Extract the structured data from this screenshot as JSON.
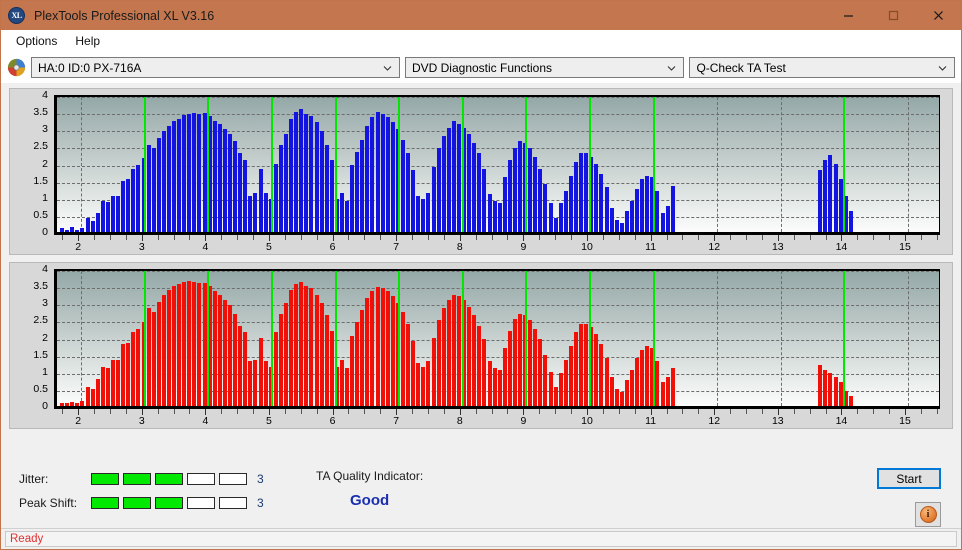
{
  "window": {
    "title": "PlexTools Professional XL V3.16",
    "app_icon": "xl-logo-icon",
    "minimize_label": "minimize-icon",
    "maximize_label": "maximize-icon",
    "close_label": "close-icon"
  },
  "menu": {
    "items": [
      {
        "label": "Options"
      },
      {
        "label": "Help"
      }
    ]
  },
  "toolbar": {
    "disc_icon": "disc-icon",
    "drive_select": {
      "value": "HA:0 ID:0  PX-716A"
    },
    "function_select": {
      "value": "DVD Diagnostic Functions"
    },
    "test_select": {
      "value": "Q-Check TA Test"
    }
  },
  "results": {
    "jitter": {
      "label": "Jitter:",
      "value": "3",
      "filled": 3,
      "total": 5
    },
    "peak_shift": {
      "label": "Peak Shift:",
      "value": "3",
      "filled": 3,
      "total": 5
    },
    "ta_quality": {
      "label": "TA Quality Indicator:",
      "value": "Good"
    },
    "start_button": "Start",
    "info_button": "info-icon"
  },
  "statusbar": {
    "text": "Ready"
  },
  "chart_data": [
    {
      "id": "jitter-chart",
      "type": "bar",
      "title": "",
      "xlabel": "",
      "ylabel": "",
      "color": "#1414e0",
      "xlim": [
        1.62,
        15.55
      ],
      "ylim": [
        0,
        4
      ],
      "yticks": [
        0,
        0.5,
        1,
        1.5,
        2,
        2.5,
        3,
        3.5,
        4
      ],
      "ytick_labels": [
        "0",
        "0.5",
        "1",
        "1.5",
        "2",
        "2.5",
        "3",
        "3.5",
        "4"
      ],
      "xticks": [
        2,
        3,
        4,
        5,
        6,
        7,
        8,
        9,
        10,
        11,
        12,
        13,
        14,
        15
      ],
      "xtick_labels": [
        "2",
        "3",
        "4",
        "5",
        "6",
        "7",
        "8",
        "9",
        "10",
        "11",
        "12",
        "13",
        "14",
        "15"
      ],
      "green_gridlines": [
        3,
        4,
        5,
        6,
        7,
        8,
        9,
        10,
        11,
        14
      ],
      "grid": true,
      "x": [
        1.7,
        1.78,
        1.86,
        1.94,
        2.02,
        2.1,
        2.18,
        2.26,
        2.34,
        2.42,
        2.5,
        2.58,
        2.66,
        2.74,
        2.82,
        2.9,
        2.98,
        3.06,
        3.14,
        3.22,
        3.3,
        3.38,
        3.46,
        3.54,
        3.62,
        3.7,
        3.78,
        3.86,
        3.94,
        4.02,
        4.1,
        4.18,
        4.26,
        4.34,
        4.42,
        4.5,
        4.58,
        4.66,
        4.74,
        4.82,
        4.9,
        4.98,
        5.06,
        5.14,
        5.22,
        5.3,
        5.38,
        5.46,
        5.54,
        5.62,
        5.7,
        5.78,
        5.86,
        5.94,
        6.02,
        6.1,
        6.18,
        6.26,
        6.34,
        6.42,
        6.5,
        6.58,
        6.66,
        6.74,
        6.82,
        6.9,
        6.98,
        7.06,
        7.14,
        7.22,
        7.3,
        7.38,
        7.46,
        7.54,
        7.62,
        7.7,
        7.78,
        7.86,
        7.94,
        8.02,
        8.1,
        8.18,
        8.26,
        8.34,
        8.42,
        8.5,
        8.58,
        8.66,
        8.74,
        8.82,
        8.9,
        8.98,
        9.06,
        9.14,
        9.22,
        9.3,
        9.38,
        9.46,
        9.54,
        9.62,
        9.7,
        9.78,
        9.86,
        9.94,
        10.02,
        10.1,
        10.18,
        10.26,
        10.34,
        10.42,
        10.5,
        10.58,
        10.66,
        10.74,
        10.82,
        10.9,
        10.98,
        11.06,
        11.14,
        11.22,
        11.3,
        13.62,
        13.7,
        13.78,
        13.86,
        13.94,
        14.02,
        14.1,
        14.18,
        14.26
      ],
      "values": [
        0.12,
        0.05,
        0.14,
        0.05,
        0.12,
        0.4,
        0.32,
        0.55,
        0.9,
        0.88,
        1.05,
        1.05,
        1.5,
        1.55,
        1.85,
        1.95,
        2.15,
        2.55,
        2.45,
        2.75,
        2.95,
        3.1,
        3.25,
        3.3,
        3.42,
        3.45,
        3.48,
        3.45,
        3.48,
        3.4,
        3.25,
        3.15,
        3.0,
        2.85,
        2.65,
        2.3,
        2.1,
        1.05,
        1.15,
        1.85,
        1.15,
        0.95,
        2.0,
        2.55,
        2.85,
        3.3,
        3.5,
        3.6,
        3.45,
        3.4,
        3.2,
        2.95,
        2.55,
        2.1,
        0.95,
        1.15,
        0.9,
        1.95,
        2.35,
        2.7,
        3.1,
        3.35,
        3.5,
        3.45,
        3.35,
        3.2,
        3.0,
        2.7,
        2.3,
        1.8,
        1.05,
        0.95,
        1.15,
        1.9,
        2.45,
        2.8,
        3.05,
        3.25,
        3.15,
        3.05,
        2.85,
        2.6,
        2.3,
        1.85,
        1.1,
        0.9,
        0.85,
        1.6,
        2.1,
        2.45,
        2.65,
        2.6,
        2.45,
        2.2,
        1.85,
        1.4,
        0.85,
        0.4,
        0.85,
        1.2,
        1.65,
        2.05,
        2.3,
        2.3,
        2.2,
        2.0,
        1.7,
        1.3,
        0.7,
        0.35,
        0.25,
        0.6,
        0.9,
        1.25,
        1.55,
        1.65,
        1.6,
        1.2,
        0.55,
        0.75,
        1.35,
        1.8,
        2.1,
        2.25,
        2.0,
        1.55,
        1.05,
        0.6
      ]
    },
    {
      "id": "peak-shift-chart",
      "type": "bar",
      "title": "",
      "xlabel": "",
      "ylabel": "",
      "color": "#f01008",
      "xlim": [
        1.62,
        15.55
      ],
      "ylim": [
        0,
        4
      ],
      "yticks": [
        0,
        0.5,
        1,
        1.5,
        2,
        2.5,
        3,
        3.5,
        4
      ],
      "ytick_labels": [
        "0",
        "0.5",
        "1",
        "1.5",
        "2",
        "2.5",
        "3",
        "3.5",
        "4"
      ],
      "xticks": [
        2,
        3,
        4,
        5,
        6,
        7,
        8,
        9,
        10,
        11,
        12,
        13,
        14,
        15
      ],
      "xtick_labels": [
        "2",
        "3",
        "4",
        "5",
        "6",
        "7",
        "8",
        "9",
        "10",
        "11",
        "12",
        "13",
        "14",
        "15"
      ],
      "green_gridlines": [
        3,
        4,
        5,
        6,
        7,
        8,
        9,
        10,
        11,
        14
      ],
      "grid": true,
      "x": [
        1.7,
        1.78,
        1.86,
        1.94,
        2.02,
        2.1,
        2.18,
        2.26,
        2.34,
        2.42,
        2.5,
        2.58,
        2.66,
        2.74,
        2.82,
        2.9,
        2.98,
        3.06,
        3.14,
        3.22,
        3.3,
        3.38,
        3.46,
        3.54,
        3.62,
        3.7,
        3.78,
        3.86,
        3.94,
        4.02,
        4.1,
        4.18,
        4.26,
        4.34,
        4.42,
        4.5,
        4.58,
        4.66,
        4.74,
        4.82,
        4.9,
        4.98,
        5.06,
        5.14,
        5.22,
        5.3,
        5.38,
        5.46,
        5.54,
        5.62,
        5.7,
        5.78,
        5.86,
        5.94,
        6.02,
        6.1,
        6.18,
        6.26,
        6.34,
        6.42,
        6.5,
        6.58,
        6.66,
        6.74,
        6.82,
        6.9,
        6.98,
        7.06,
        7.14,
        7.22,
        7.3,
        7.38,
        7.46,
        7.54,
        7.62,
        7.7,
        7.78,
        7.86,
        7.94,
        8.02,
        8.1,
        8.18,
        8.26,
        8.34,
        8.42,
        8.5,
        8.58,
        8.66,
        8.74,
        8.82,
        8.9,
        8.98,
        9.06,
        9.14,
        9.22,
        9.3,
        9.38,
        9.46,
        9.54,
        9.62,
        9.7,
        9.78,
        9.86,
        9.94,
        10.02,
        10.1,
        10.18,
        10.26,
        10.34,
        10.42,
        10.5,
        10.58,
        10.66,
        10.74,
        10.82,
        10.9,
        10.98,
        11.06,
        11.14,
        11.22,
        11.3,
        13.62,
        13.7,
        13.78,
        13.86,
        13.94,
        14.02,
        14.1,
        14.18,
        14.26
      ],
      "values": [
        0.1,
        0.08,
        0.12,
        0.1,
        0.15,
        0.55,
        0.5,
        0.8,
        1.15,
        1.1,
        1.35,
        1.35,
        1.8,
        1.85,
        2.15,
        2.25,
        2.45,
        2.85,
        2.75,
        3.05,
        3.25,
        3.4,
        3.5,
        3.55,
        3.62,
        3.65,
        3.62,
        3.6,
        3.58,
        3.5,
        3.35,
        3.25,
        3.1,
        2.95,
        2.7,
        2.35,
        2.15,
        1.3,
        1.35,
        2.0,
        1.3,
        1.15,
        2.15,
        2.7,
        3.0,
        3.4,
        3.55,
        3.62,
        3.5,
        3.45,
        3.25,
        3.0,
        2.65,
        2.2,
        1.15,
        1.35,
        1.1,
        2.05,
        2.45,
        2.8,
        3.15,
        3.35,
        3.48,
        3.45,
        3.35,
        3.2,
        3.0,
        2.75,
        2.4,
        1.9,
        1.25,
        1.15,
        1.3,
        2.0,
        2.5,
        2.85,
        3.1,
        3.25,
        3.2,
        3.1,
        2.9,
        2.65,
        2.35,
        1.95,
        1.3,
        1.1,
        1.05,
        1.7,
        2.2,
        2.55,
        2.7,
        2.65,
        2.5,
        2.25,
        1.95,
        1.5,
        1.0,
        0.55,
        0.95,
        1.35,
        1.75,
        2.15,
        2.4,
        2.4,
        2.3,
        2.1,
        1.8,
        1.4,
        0.85,
        0.5,
        0.4,
        0.75,
        1.05,
        1.4,
        1.65,
        1.75,
        1.7,
        1.3,
        0.7,
        0.85,
        1.1,
        1.2,
        1.05,
        0.95,
        0.85,
        0.7,
        0.45,
        0.3
      ]
    }
  ]
}
